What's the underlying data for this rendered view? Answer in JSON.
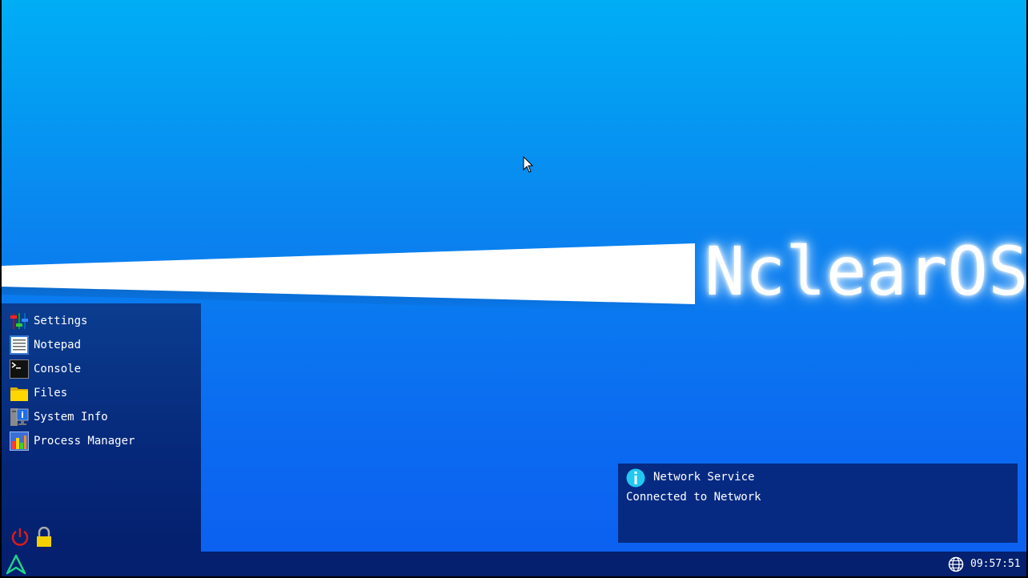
{
  "desktop": {
    "logo_text": "NclearOS",
    "background_top": "#00aef5",
    "background_bottom": "#0c5ff0"
  },
  "start_menu": {
    "items": [
      {
        "label": "Settings",
        "icon": "settings-sliders-icon"
      },
      {
        "label": "Notepad",
        "icon": "notepad-icon"
      },
      {
        "label": "Console",
        "icon": "console-icon"
      },
      {
        "label": "Files",
        "icon": "folder-icon"
      },
      {
        "label": "System Info",
        "icon": "system-info-icon"
      },
      {
        "label": "Process Manager",
        "icon": "process-manager-icon"
      }
    ],
    "power_icon": "power-icon",
    "lock_icon": "lock-icon"
  },
  "notification": {
    "title": "Network Service",
    "body": "Connected to Network",
    "icon": "info-icon"
  },
  "taskbar": {
    "start_icon": "start-arrow-icon",
    "network_icon": "globe-icon",
    "clock": "09:57:51"
  },
  "colors": {
    "panel": "#04206e",
    "notification_bg": "#062a82",
    "power_red": "#e01a1a",
    "lock_yellow": "#f5d000",
    "start_green": "#1fd48a"
  }
}
